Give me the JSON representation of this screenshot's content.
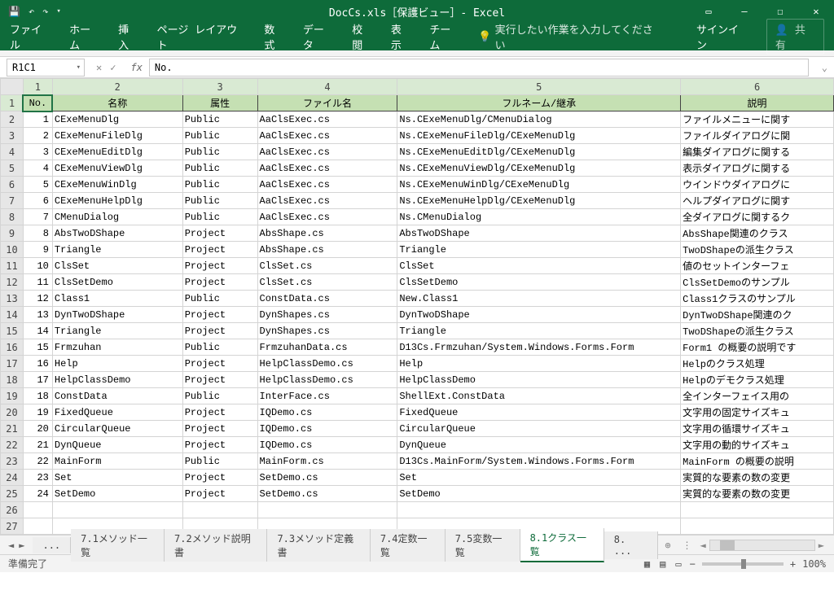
{
  "window": {
    "title": "DocCs.xls［保護ビュー］- Excel"
  },
  "qat": {
    "undo": "↶",
    "redo": "↷"
  },
  "ribbon": {
    "file": "ファイル",
    "home": "ホーム",
    "insert": "挿入",
    "page": "ページ レイアウト",
    "formula": "数式",
    "data": "データ",
    "review": "校閲",
    "view": "表示",
    "team": "チーム",
    "tell": "実行したい作業を入力してください",
    "signin": "サインイン",
    "share": "共有"
  },
  "fx": {
    "namebox": "R1C1",
    "value": "No."
  },
  "cols": [
    "1",
    "2",
    "3",
    "4",
    "5",
    "6"
  ],
  "headers": {
    "no": "No.",
    "name": "名称",
    "attr": "属性",
    "file": "ファイル名",
    "full": "フルネーム/継承",
    "desc": "説明"
  },
  "rows": [
    {
      "n": "1",
      "name": "CExeMenuDlg",
      "attr": "Public",
      "file": "AaClsExec.cs",
      "full": "Ns.CExeMenuDlg/CMenuDialog",
      "desc": "ファイルメニューに関す"
    },
    {
      "n": "2",
      "name": "CExeMenuFileDlg",
      "attr": "Public",
      "file": "AaClsExec.cs",
      "full": "Ns.CExeMenuFileDlg/CExeMenuDlg",
      "desc": "ファイルダイアログに関"
    },
    {
      "n": "3",
      "name": "CExeMenuEditDlg",
      "attr": "Public",
      "file": "AaClsExec.cs",
      "full": "Ns.CExeMenuEditDlg/CExeMenuDlg",
      "desc": "編集ダイアログに関する"
    },
    {
      "n": "4",
      "name": "CExeMenuViewDlg",
      "attr": "Public",
      "file": "AaClsExec.cs",
      "full": "Ns.CExeMenuViewDlg/CExeMenuDlg",
      "desc": "表示ダイアログに関する"
    },
    {
      "n": "5",
      "name": "CExeMenuWinDlg",
      "attr": "Public",
      "file": "AaClsExec.cs",
      "full": "Ns.CExeMenuWinDlg/CExeMenuDlg",
      "desc": "ウインドウダイアログに"
    },
    {
      "n": "6",
      "name": "CExeMenuHelpDlg",
      "attr": "Public",
      "file": "AaClsExec.cs",
      "full": "Ns.CExeMenuHelpDlg/CExeMenuDlg",
      "desc": "ヘルプダイアログに関す"
    },
    {
      "n": "7",
      "name": "CMenuDialog",
      "attr": "Public",
      "file": "AaClsExec.cs",
      "full": "Ns.CMenuDialog",
      "desc": "全ダイアログに関するク"
    },
    {
      "n": "8",
      "name": "AbsTwoDShape",
      "attr": "Project",
      "file": "AbsShape.cs",
      "full": "AbsTwoDShape",
      "desc": "AbsShape関連のクラス"
    },
    {
      "n": "9",
      "name": "Triangle",
      "attr": "Project",
      "file": "AbsShape.cs",
      "full": "Triangle",
      "desc": "TwoDShapeの派生クラス"
    },
    {
      "n": "10",
      "name": "ClsSet",
      "attr": "Project",
      "file": "ClsSet.cs",
      "full": "ClsSet",
      "desc": "値のセットインターフェ"
    },
    {
      "n": "11",
      "name": "ClsSetDemo",
      "attr": "Project",
      "file": "ClsSet.cs",
      "full": "ClsSetDemo",
      "desc": "ClsSetDemoのサンプル"
    },
    {
      "n": "12",
      "name": "Class1",
      "attr": "Public",
      "file": "ConstData.cs",
      "full": "New.Class1",
      "desc": "Class1クラスのサンプル"
    },
    {
      "n": "13",
      "name": "DynTwoDShape",
      "attr": "Project",
      "file": "DynShapes.cs",
      "full": "DynTwoDShape",
      "desc": "DynTwoDShape関連のク"
    },
    {
      "n": "14",
      "name": "Triangle",
      "attr": "Project",
      "file": "DynShapes.cs",
      "full": "Triangle",
      "desc": "TwoDShapeの派生クラス"
    },
    {
      "n": "15",
      "name": "Frmzuhan",
      "attr": "Public",
      "file": "FrmzuhanData.cs",
      "full": "D13Cs.Frmzuhan/System.Windows.Forms.Form",
      "desc": "Form1 の概要の説明です"
    },
    {
      "n": "16",
      "name": "Help",
      "attr": "Project",
      "file": "HelpClassDemo.cs",
      "full": "Help",
      "desc": "Helpのクラス処理"
    },
    {
      "n": "17",
      "name": "HelpClassDemo",
      "attr": "Project",
      "file": "HelpClassDemo.cs",
      "full": "HelpClassDemo",
      "desc": "Helpのデモクラス処理"
    },
    {
      "n": "18",
      "name": "ConstData",
      "attr": "Public",
      "file": "InterFace.cs",
      "full": "ShellExt.ConstData",
      "desc": "全インターフェイス用の"
    },
    {
      "n": "19",
      "name": "FixedQueue",
      "attr": "Project",
      "file": "IQDemo.cs",
      "full": "FixedQueue",
      "desc": "文字用の固定サイズキュ"
    },
    {
      "n": "20",
      "name": "CircularQueue",
      "attr": "Project",
      "file": "IQDemo.cs",
      "full": "CircularQueue",
      "desc": "文字用の循環サイズキュ"
    },
    {
      "n": "21",
      "name": "DynQueue",
      "attr": "Project",
      "file": "IQDemo.cs",
      "full": "DynQueue",
      "desc": "文字用の動的サイズキュ"
    },
    {
      "n": "22",
      "name": "MainForm",
      "attr": "Public",
      "file": "MainForm.cs",
      "full": "D13Cs.MainForm/System.Windows.Forms.Form",
      "desc": "MainForm の概要の説明"
    },
    {
      "n": "23",
      "name": "Set",
      "attr": "Project",
      "file": "SetDemo.cs",
      "full": "Set",
      "desc": "実質的な要素の数の変更"
    },
    {
      "n": "24",
      "name": "SetDemo",
      "attr": "Project",
      "file": "SetDemo.cs",
      "full": "SetDemo",
      "desc": "実質的な要素の数の変更"
    }
  ],
  "tabs": {
    "ellipsis": "...",
    "t1": "7.1メソッド一覧",
    "t2": "7.2メソッド説明書",
    "t3": "7.3メソッド定義書",
    "t4": "7.4定数一覧",
    "t5": "7.5変数一覧",
    "active": "8.1クラス一覧",
    "t7": "8. ..."
  },
  "status": {
    "ready": "準備完了",
    "zoom": "100%"
  }
}
